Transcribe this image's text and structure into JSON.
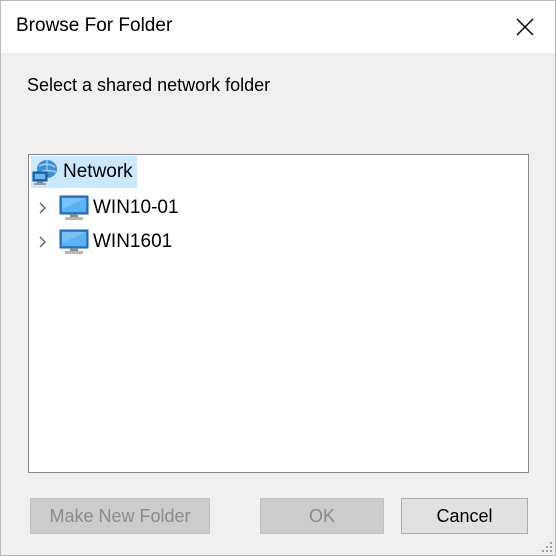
{
  "window": {
    "title": "Browse For Folder",
    "close_icon": "close-icon"
  },
  "prompt": "Select a shared network folder",
  "tree": {
    "root": {
      "label": "Network",
      "icon": "network-icon",
      "selected": true
    },
    "children": [
      {
        "label": "WIN10-01",
        "icon": "computer-icon",
        "expander_icon": "chevron-right-icon"
      },
      {
        "label": "WIN1601",
        "icon": "computer-icon",
        "expander_icon": "chevron-right-icon"
      }
    ]
  },
  "buttons": {
    "make_new_folder": {
      "label": "Make New Folder",
      "enabled": false
    },
    "ok": {
      "label": "OK",
      "enabled": false
    },
    "cancel": {
      "label": "Cancel",
      "enabled": true
    }
  },
  "colors": {
    "selection_bg": "#cce8ff",
    "dialog_bg": "#f0f0f0",
    "titlebar_bg": "#ffffff"
  }
}
